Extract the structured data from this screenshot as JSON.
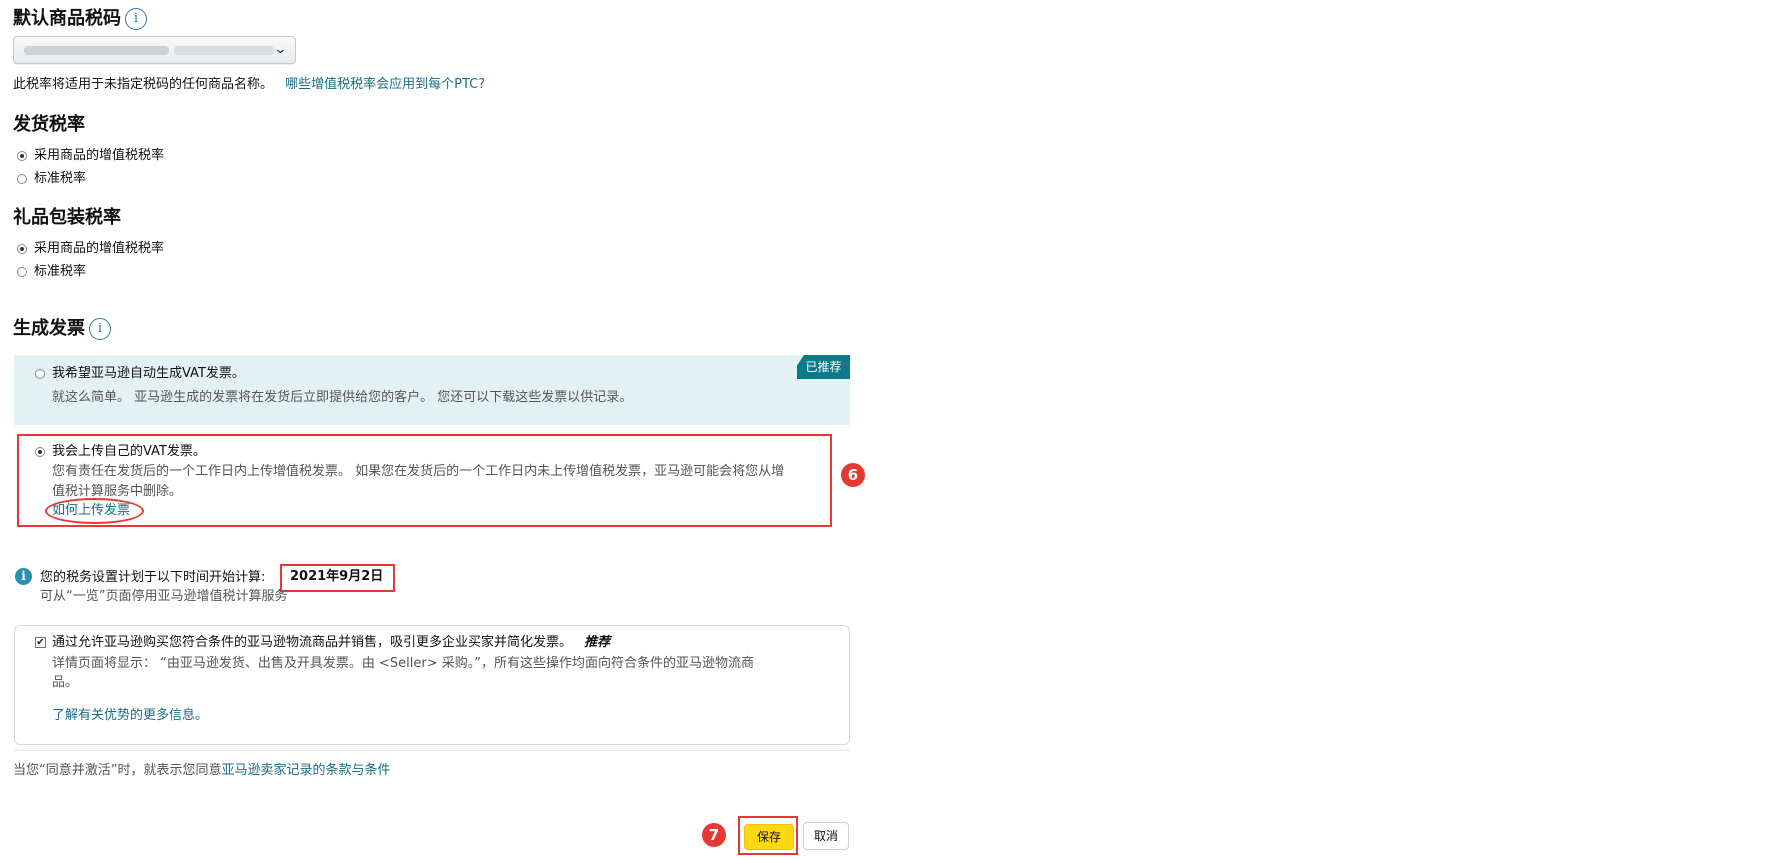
{
  "default_tax_code": {
    "title": "默认商品税码",
    "info_glyph": "i",
    "chevron": "⌄",
    "note": "此税率将适用于未指定税码的任何商品名称。",
    "link": "哪些增值税税率会应用到每个PTC?"
  },
  "shipping_rate": {
    "title": "发货税率",
    "options": [
      "采用商品的增值税税率",
      "标准税率"
    ],
    "selected": 0
  },
  "gift_wrap_rate": {
    "title": "礼品包装税率",
    "options": [
      "采用商品的增值税税率",
      "标准税率"
    ],
    "selected": 0
  },
  "invoice": {
    "title": "生成发票",
    "info_glyph": "i",
    "recommended_badge": "已推荐",
    "option_auto": {
      "label": "我希望亚马逊自动生成VAT发票。",
      "desc": "就这么简单。 亚马逊生成的发票将在发货后立即提供给您的客户。 您还可以下载这些发票以供记录。"
    },
    "option_upload": {
      "label": "我会上传自己的VAT发票。",
      "desc_line1": "您有责任在发货后的一个工作日内上传增值税发票。 如果您在发货后的一个工作日内未上传增值税发票，亚马逊可能会将您从增",
      "desc_line2": "值税计算服务中删除。",
      "link": "如何上传发票"
    },
    "selected": "upload"
  },
  "annotations": {
    "step6": "6",
    "step7": "7",
    "highlight_color": "#e53935"
  },
  "schedule": {
    "info_glyph": "i",
    "text": "您的税务设置计划于以下时间开始计算:",
    "date": "2021年9月2日",
    "sub": "可从“一览”页面停用亚马逊增值税计算服务"
  },
  "business": {
    "checked": true,
    "check_glyph": "✔",
    "label": "通过允许亚马逊购买您符合条件的亚马逊物流商品并销售，吸引更多企业买家并简化发票。",
    "tag": "推荐",
    "desc_line1": "详情页面将显示： “由亚马逊发货、出售及开具发票。由 <Seller> 采购。”，所有这些操作均面向符合条件的亚马逊物流商",
    "desc_line2": "品。",
    "link": "了解有关优势的更多信息。"
  },
  "terms": {
    "prefix": "当您“同意并激活”时，就表示您同意",
    "link": "亚马逊卖家记录的条款与条件"
  },
  "buttons": {
    "save": "保存",
    "cancel": "取消"
  },
  "colors": {
    "link": "#1b6c85",
    "recommended_bg": "#e4f1f3",
    "badge": "#0a7a8a",
    "save_button": "#ffd814",
    "info": "#2a8fb0"
  }
}
